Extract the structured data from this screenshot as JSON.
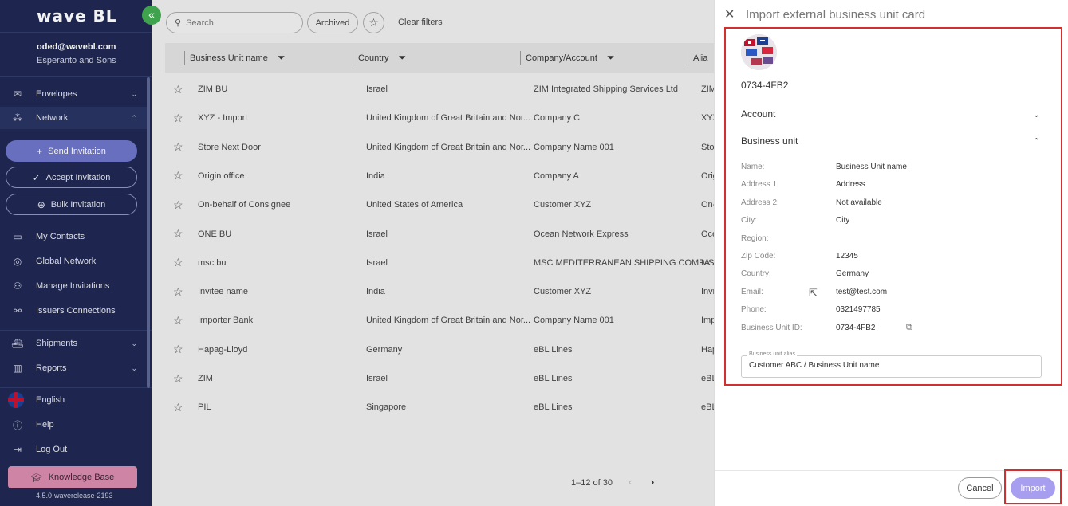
{
  "app": {
    "logo": "wave BL",
    "collapse_icon": "«",
    "user_email": "oded@wavebl.com",
    "company": "Esperanto and Sons",
    "version": "4.5.0-waverelease-2193"
  },
  "sidebar": {
    "envelopes": "Envelopes",
    "network": "Network",
    "send_invitation": "Send Invitation",
    "accept_invitation": "Accept Invitation",
    "bulk_invitation": "Bulk Invitation",
    "my_contacts": "My Contacts",
    "global_network": "Global Network",
    "manage_invitations": "Manage Invitations",
    "issuers_connections": "Issuers Connections",
    "shipments": "Shipments",
    "reports": "Reports",
    "language": "English",
    "help": "Help",
    "logout": "Log Out",
    "knowledge_base": "Knowledge Base"
  },
  "toolbar": {
    "search_placeholder": "Search",
    "archived": "Archived",
    "clear_filters": "Clear filters"
  },
  "table": {
    "columns": [
      "Business Unit name",
      "Country",
      "Company/Account",
      "Alia"
    ],
    "rows": [
      [
        "ZIM BU",
        "Israel",
        "ZIM Integrated Shipping Services Ltd",
        "ZIM"
      ],
      [
        "XYZ - Import",
        "United Kingdom of Great Britain and Nor...",
        "Company C",
        "XYZ"
      ],
      [
        "Store Next Door",
        "United Kingdom of Great Britain and Nor...",
        "Company Name 001",
        "Sto"
      ],
      [
        "Origin office",
        "India",
        "Company A",
        "Orig"
      ],
      [
        "On-behalf of Consignee",
        "United States of America",
        "Customer XYZ",
        "On-"
      ],
      [
        "ONE BU",
        "Israel",
        "Ocean Network Express",
        "Oce"
      ],
      [
        "msc bu",
        "Israel",
        "MSC MEDITERRANEAN SHIPPING COMPA...",
        "MSC"
      ],
      [
        "Invitee name",
        "India",
        "Customer XYZ",
        "Invi"
      ],
      [
        "Importer Bank",
        "United Kingdom of Great Britain and Nor...",
        "Company Name 001",
        "Imp"
      ],
      [
        "Hapag-Lloyd",
        "Germany",
        "eBL Lines",
        "Hap"
      ],
      [
        "ZIM",
        "Israel",
        "eBL Lines",
        "eBL"
      ],
      [
        "PIL",
        "Singapore",
        "eBL Lines",
        "eBL"
      ]
    ],
    "pagination": "1–12 of 30"
  },
  "drawer": {
    "title": "Import external business unit card",
    "card_id": "0734-4FB2",
    "account_section": "Account",
    "business_unit_section": "Business unit",
    "fields": [
      {
        "label": "Name:",
        "value": "Business Unit name"
      },
      {
        "label": "Address 1:",
        "value": "Address"
      },
      {
        "label": "Address 2:",
        "value": "Not available"
      },
      {
        "label": "City:",
        "value": "City"
      },
      {
        "label": "Region:",
        "value": ""
      },
      {
        "label": "Zip Code:",
        "value": "12345"
      },
      {
        "label": "Country:",
        "value": "Germany"
      },
      {
        "label": "Email:",
        "value": "test@test.com"
      },
      {
        "label": "Phone:",
        "value": "0321497785"
      },
      {
        "label": "Business Unit ID:",
        "value": "0734-4FB2"
      }
    ],
    "alias_label": "Business unit alias",
    "alias_value": "Customer ABC / Business Unit name",
    "cancel": "Cancel",
    "import": "Import"
  },
  "colors": {
    "sidebar_bg": "#1e2752",
    "accent_purple": "#6d74c9",
    "import_button": "#a79ef0",
    "highlight_red": "#d32f2f",
    "knowledge_base": "#d98cae"
  }
}
